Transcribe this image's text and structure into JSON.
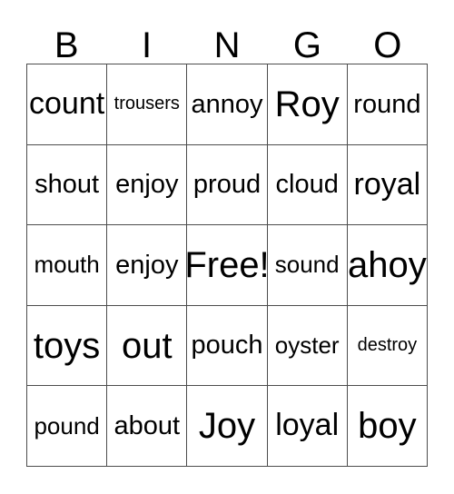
{
  "card": {
    "title_letters": [
      "B",
      "I",
      "N",
      "G",
      "O"
    ],
    "border_color": "#4d4d4d",
    "text_color": "#000000",
    "background_color": "#ffffff",
    "rows": 5,
    "columns": 5
  },
  "grid": {
    "row1": [
      {
        "text": "count",
        "size": "lg"
      },
      {
        "text": "trousers",
        "size": "xs"
      },
      {
        "text": "annoy",
        "size": "md"
      },
      {
        "text": "Roy",
        "size": "xl"
      },
      {
        "text": "round",
        "size": "md"
      }
    ],
    "row2": [
      {
        "text": "shout",
        "size": "md"
      },
      {
        "text": "enjoy",
        "size": "md"
      },
      {
        "text": "proud",
        "size": "md"
      },
      {
        "text": "cloud",
        "size": "md"
      },
      {
        "text": "royal",
        "size": "lg"
      }
    ],
    "row3": [
      {
        "text": "mouth",
        "size": "sm"
      },
      {
        "text": "enjoy",
        "size": "md"
      },
      {
        "text": "Free!",
        "size": "xl"
      },
      {
        "text": "sound",
        "size": "sm"
      },
      {
        "text": "ahoy",
        "size": "xl"
      }
    ],
    "row4": [
      {
        "text": "toys",
        "size": "xl"
      },
      {
        "text": "out",
        "size": "xl"
      },
      {
        "text": "pouch",
        "size": "md"
      },
      {
        "text": "oyster",
        "size": "sm"
      },
      {
        "text": "destroy",
        "size": "xs"
      }
    ],
    "row5": [
      {
        "text": "pound",
        "size": "sm"
      },
      {
        "text": "about",
        "size": "md"
      },
      {
        "text": "Joy",
        "size": "xl"
      },
      {
        "text": "loyal",
        "size": "lg"
      },
      {
        "text": "boy",
        "size": "xl"
      }
    ]
  }
}
